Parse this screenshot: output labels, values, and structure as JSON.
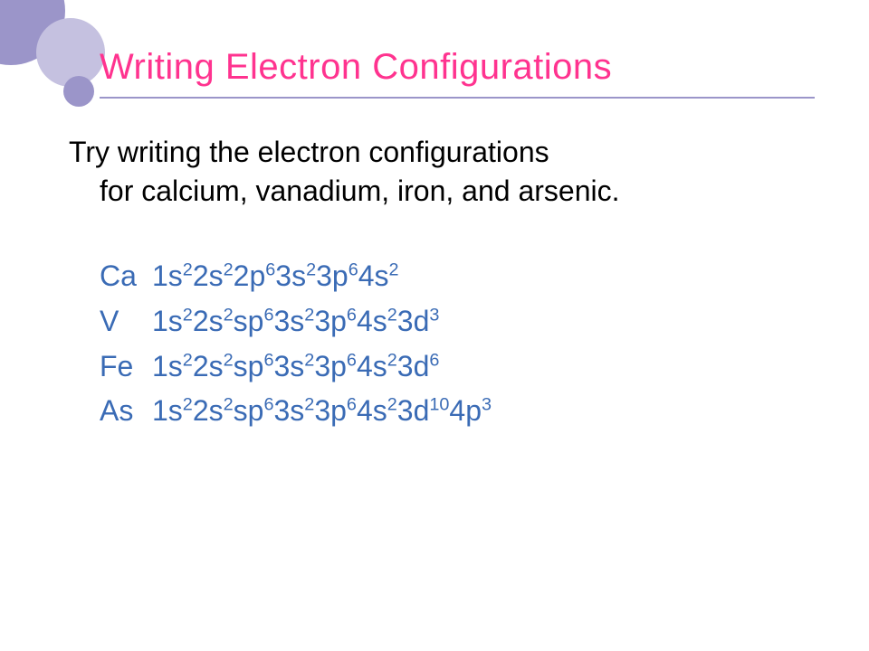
{
  "title": "Writing Electron Configurations",
  "prompt_line1": "Try writing the electron configurations",
  "prompt_rest": "for calcium, vanadium, iron, and arsenic.",
  "configs": [
    {
      "symbol": "Ca",
      "tokens": [
        {
          "base": "1s",
          "sup": "2"
        },
        {
          "base": "2s",
          "sup": "2"
        },
        {
          "base": "2p",
          "sup": "6"
        },
        {
          "base": "3s",
          "sup": "2"
        },
        {
          "base": "3p",
          "sup": "6"
        },
        {
          "base": "4s",
          "sup": "2"
        }
      ]
    },
    {
      "symbol": "V",
      "tokens": [
        {
          "base": "1s",
          "sup": "2"
        },
        {
          "base": "2s",
          "sup": "2"
        },
        {
          "base": "sp",
          "sup": "6"
        },
        {
          "base": "3s",
          "sup": "2"
        },
        {
          "base": "3p",
          "sup": "6"
        },
        {
          "base": "4s",
          "sup": "2"
        },
        {
          "base": "3d",
          "sup": "3"
        }
      ]
    },
    {
      "symbol": "Fe",
      "tokens": [
        {
          "base": "1s",
          "sup": "2"
        },
        {
          "base": "2s",
          "sup": "2"
        },
        {
          "base": "sp",
          "sup": "6"
        },
        {
          "base": "3s",
          "sup": "2"
        },
        {
          "base": "3p",
          "sup": "6"
        },
        {
          "base": "4s",
          "sup": "2"
        },
        {
          "base": "3d",
          "sup": "6"
        }
      ]
    },
    {
      "symbol": "As",
      "tokens": [
        {
          "base": "1s",
          "sup": "2"
        },
        {
          "base": "2s",
          "sup": "2"
        },
        {
          "base": "sp",
          "sup": "6"
        },
        {
          "base": "3s",
          "sup": "2"
        },
        {
          "base": "3p",
          "sup": "6"
        },
        {
          "base": "4s",
          "sup": "2"
        },
        {
          "base": "3d",
          "sup": "10"
        },
        {
          "base": "4p",
          "sup": "3"
        }
      ]
    }
  ],
  "colors": {
    "pink": "#ff338f",
    "purple": "#9b95c9",
    "answer_blue": "#3a6bb5"
  }
}
